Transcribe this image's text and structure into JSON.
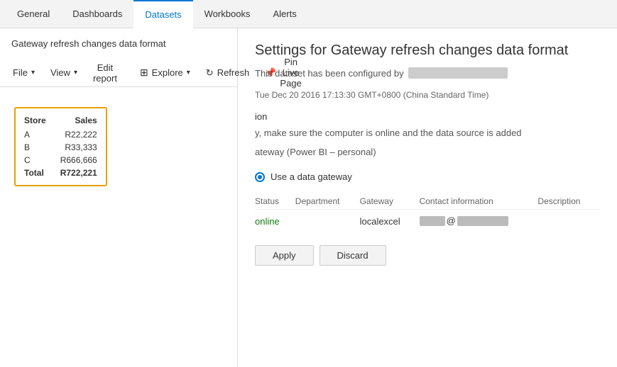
{
  "topNav": {
    "tabs": [
      {
        "label": "General",
        "active": false
      },
      {
        "label": "Dashboards",
        "active": false
      },
      {
        "label": "Datasets",
        "active": true
      },
      {
        "label": "Workbooks",
        "active": false
      },
      {
        "label": "Alerts",
        "active": false
      }
    ]
  },
  "sidebar": {
    "item": "Gateway refresh changes data format"
  },
  "toolbar": {
    "file_label": "File",
    "view_label": "View",
    "edit_report_label": "Edit report",
    "explore_label": "Explore",
    "refresh_label": "Refresh",
    "pin_live_page_label": "Pin Live Page"
  },
  "dataTable": {
    "headers": [
      "Store",
      "Sales"
    ],
    "rows": [
      {
        "store": "A",
        "sales": "R22,222"
      },
      {
        "store": "B",
        "sales": "R33,333"
      },
      {
        "store": "C",
        "sales": "R666,666"
      }
    ],
    "total_label": "Total",
    "total_value": "R722,221"
  },
  "settings": {
    "title": "Settings for Gateway refresh changes data format",
    "config_prefix": "This dataset has been configured by",
    "timestamp": "Tue Dec 20 2016 17:13:30 GMT+0800 (China Standard Time)",
    "partial_text": "y, make sure the computer is online and the data source is added",
    "partial_ion": "ion",
    "gateway_text": "ateway (Power BI – personal)",
    "radio_label": "Use a data gateway",
    "table": {
      "headers": [
        "Status",
        "Department",
        "Gateway",
        "Contact information",
        "Description"
      ],
      "row": {
        "status": "online",
        "department": "",
        "gateway": "localexcel",
        "contact_at": "@",
        "description": ""
      }
    },
    "apply_label": "Apply",
    "discard_label": "Discard"
  }
}
